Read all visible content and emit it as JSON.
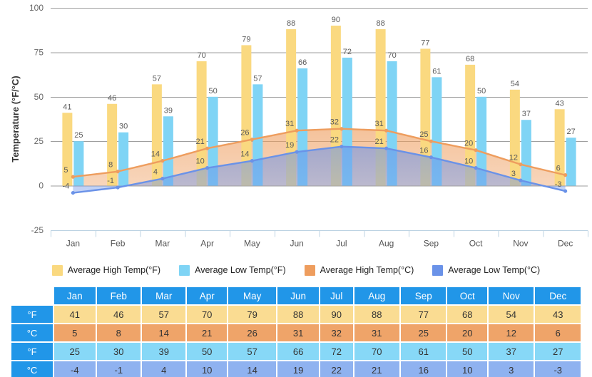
{
  "chart_data": {
    "type": "bar",
    "title": "",
    "xlabel": "",
    "ylabel": "Temperature (°F/°C)",
    "ylim": [
      -25,
      100
    ],
    "yticks": [
      100,
      75,
      50,
      25,
      0,
      -25
    ],
    "grid": true,
    "legend_position": "bottom",
    "categories": [
      "Jan",
      "Feb",
      "Mar",
      "Apr",
      "May",
      "Jun",
      "Jul",
      "Aug",
      "Sep",
      "Oct",
      "Nov",
      "Dec"
    ],
    "series": [
      {
        "name": "Average High Temp(°F)",
        "type": "bar",
        "color": "#fad980",
        "values": [
          41,
          46,
          57,
          70,
          79,
          88,
          90,
          88,
          77,
          68,
          54,
          43
        ]
      },
      {
        "name": "Average Low Temp(°F)",
        "type": "bar",
        "color": "#7fd4f5",
        "values": [
          25,
          30,
          39,
          50,
          57,
          66,
          72,
          70,
          61,
          50,
          37,
          27
        ]
      },
      {
        "name": "Average High Temp(°C)",
        "type": "area",
        "color": "#ee9d5e",
        "values": [
          5,
          8,
          14,
          21,
          26,
          31,
          32,
          31,
          25,
          20,
          12,
          6
        ]
      },
      {
        "name": "Average Low Temp(°C)",
        "type": "area",
        "color": "#6a92e8",
        "values": [
          -4,
          -1,
          4,
          10,
          14,
          19,
          22,
          21,
          16,
          10,
          3,
          -3
        ]
      }
    ]
  },
  "legend": {
    "items": [
      {
        "label": "Average High Temp(°F)",
        "color": "#fad980"
      },
      {
        "label": "Average Low Temp(°F)",
        "color": "#7fd4f5"
      },
      {
        "label": "Average High Temp(°C)",
        "color": "#ee9d5e"
      },
      {
        "label": "Average Low Temp(°C)",
        "color": "#6a92e8"
      }
    ]
  },
  "table": {
    "corner_label": "",
    "columns": [
      "Jan",
      "Feb",
      "Mar",
      "Apr",
      "May",
      "Jun",
      "Jul",
      "Aug",
      "Sep",
      "Oct",
      "Nov",
      "Dec"
    ],
    "rows": [
      {
        "label": "°F",
        "unit_class": "c-hf",
        "values": [
          41,
          46,
          57,
          70,
          79,
          88,
          90,
          88,
          77,
          68,
          54,
          43
        ]
      },
      {
        "label": "°C",
        "unit_class": "c-hc",
        "values": [
          5,
          8,
          14,
          21,
          26,
          31,
          32,
          31,
          25,
          20,
          12,
          6
        ]
      },
      {
        "label": "°F",
        "unit_class": "c-lf",
        "values": [
          25,
          30,
          39,
          50,
          57,
          66,
          72,
          70,
          61,
          50,
          37,
          27
        ]
      },
      {
        "label": "°C",
        "unit_class": "c-lc",
        "values": [
          -4,
          -1,
          4,
          10,
          14,
          19,
          22,
          21,
          16,
          10,
          3,
          -3
        ]
      }
    ]
  },
  "colors": {
    "high_f": "#fad980",
    "low_f": "#7fd4f5",
    "high_c": "#ee9d5e",
    "low_c": "#6a92e8",
    "header_blue": "#2196e8",
    "grid": "#9e9e9e"
  }
}
